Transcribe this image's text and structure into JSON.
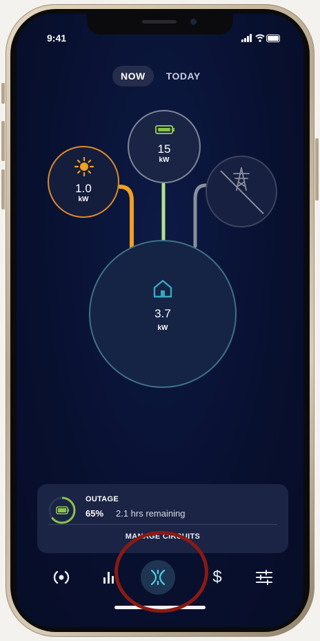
{
  "status_bar": {
    "time": "9:41",
    "icons": [
      "signal-icon",
      "wifi-icon",
      "battery-icon"
    ]
  },
  "segment": {
    "options": [
      {
        "label": "NOW",
        "selected": true
      },
      {
        "label": "TODAY",
        "selected": false
      }
    ]
  },
  "energy_flow": {
    "solar": {
      "value": "1.0",
      "unit": "kW",
      "icon": "sun-icon",
      "color": "#e08a2a"
    },
    "battery": {
      "value": "15",
      "unit": "kW",
      "icon": "battery-icon",
      "color": "#8bc34a"
    },
    "grid": {
      "icon": "power-tower-offline-icon",
      "status": "offline"
    },
    "home": {
      "value": "3.7",
      "unit": "kW",
      "icon": "house-icon",
      "color": "#3aa8c1"
    }
  },
  "outage_card": {
    "title": "OUTAGE",
    "percent": "65%",
    "percent_value": 0.65,
    "remaining": "2.1 hrs remaining",
    "action": "MANAGE CIRCUITS"
  },
  "tab_bar": {
    "items": [
      {
        "icon": "status-icon"
      },
      {
        "icon": "bar-chart-icon"
      },
      {
        "icon": "energy-flow-icon",
        "active": true
      },
      {
        "icon": "dollar-icon",
        "glyph": "$"
      },
      {
        "icon": "sliders-icon"
      }
    ]
  },
  "colors": {
    "background": "#08102f",
    "solar": "#e08a2a",
    "battery": "#8bc34a",
    "home": "#3aa8c1",
    "grid_line": "#8a8f9c",
    "highlight": "#8b1a12"
  }
}
